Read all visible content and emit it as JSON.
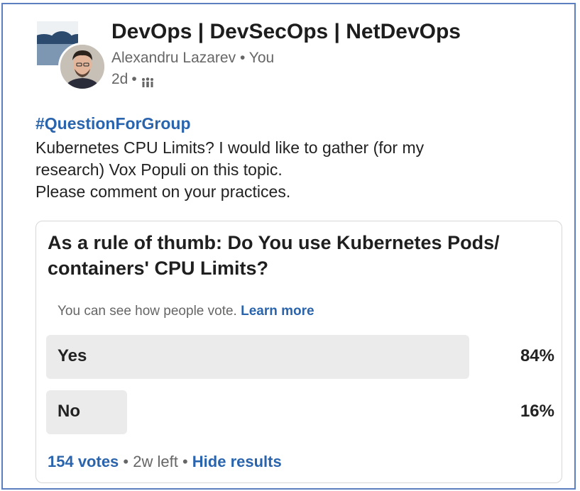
{
  "post": {
    "group_name": "DevOps | DevSecOps | NetDevOps",
    "author": "Alexandru Lazarev",
    "separator": "•",
    "viewer": "You",
    "age": "2d",
    "visibility_icon": "group-icon",
    "hashtag": "#QuestionForGroup",
    "text_lines": [
      "Kubernetes CPU Limits? I would like to gather (for my",
      "research) Vox Populi on this topic.",
      "Please comment on your practices."
    ]
  },
  "poll": {
    "question_lines": [
      "As a rule of thumb: Do You use Kubernetes Pods/",
      "containers' CPU Limits?"
    ],
    "visibility_text": "You can see how people vote.",
    "learn_more": "Learn more",
    "options": [
      {
        "label": "Yes",
        "percent_text": "84%",
        "fraction": 0.84
      },
      {
        "label": "No",
        "percent_text": "16%",
        "fraction": 0.16
      }
    ],
    "votes": "154 votes",
    "time_left": "2w left",
    "hide_results": "Hide results",
    "dot": "•"
  },
  "colors": {
    "link": "#2a64ad",
    "bar": "#ebebeb",
    "frame": "#5b7fbf"
  }
}
